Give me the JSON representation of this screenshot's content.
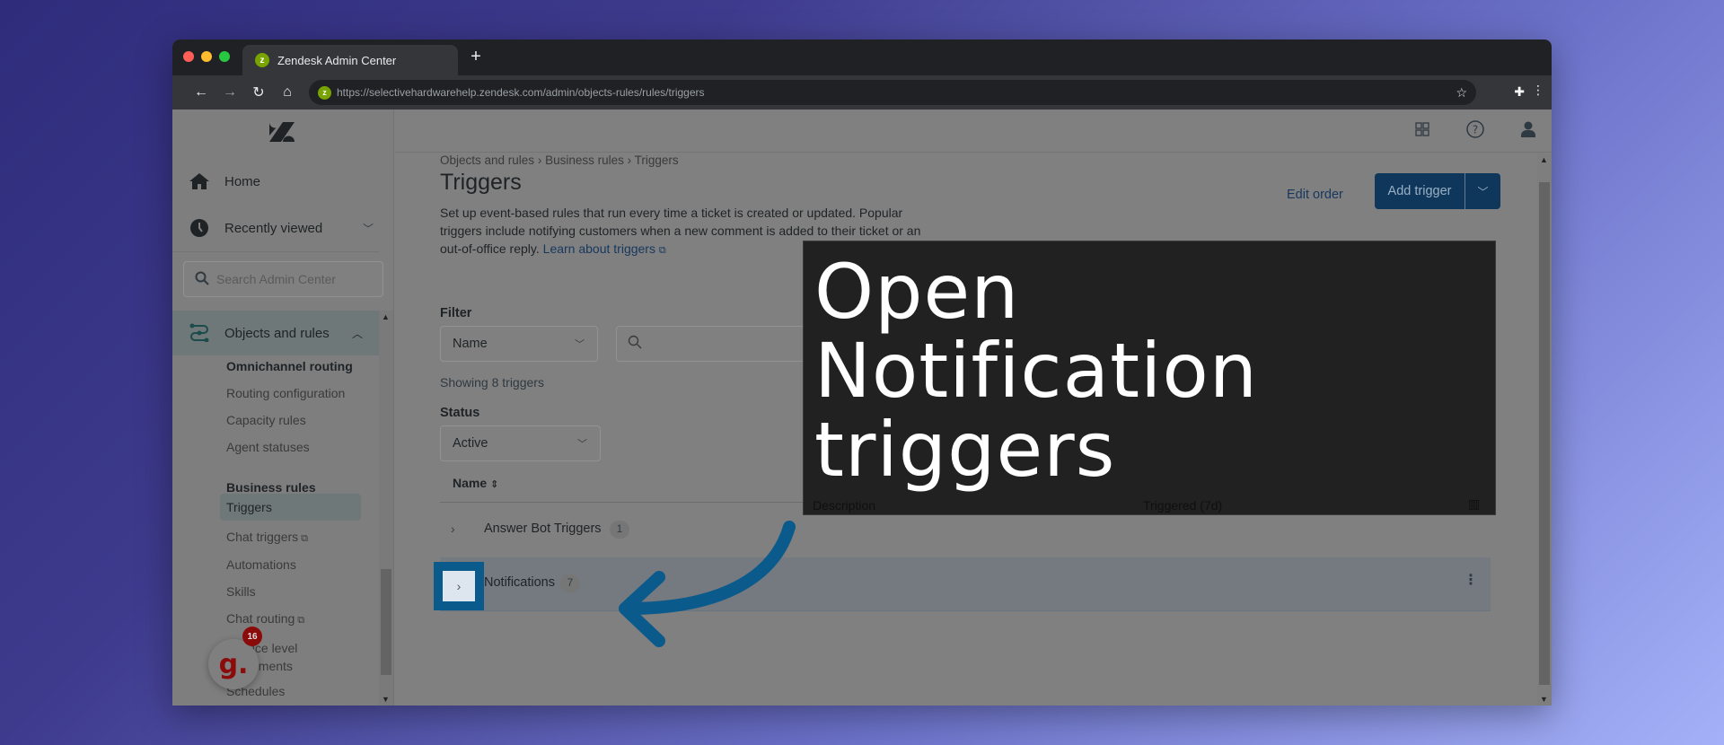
{
  "browser": {
    "tab_title": "Zendesk Admin Center",
    "favicon_letter": "z",
    "new_tab": "+",
    "url": "https://selectivehardwarehelp.zendesk.com/admin/objects-rules/rules/triggers",
    "nav": {
      "back": "←",
      "forward": "→",
      "reload": "↻",
      "home": "⌂"
    },
    "star": "☆",
    "extensions": "✚",
    "menu": "⋮"
  },
  "sidebar": {
    "home": "Home",
    "recently_viewed": "Recently viewed",
    "search_placeholder": "Search Admin Center",
    "section": "Objects and rules",
    "groups": [
      {
        "heading": "Omnichannel routing",
        "items": [
          "Routing configuration",
          "Capacity rules",
          "Agent statuses"
        ]
      },
      {
        "heading": "Business rules",
        "items": [
          "Triggers",
          "Chat triggers",
          "Automations",
          "Skills",
          "Chat routing",
          "Service level agreements",
          "Schedules"
        ]
      }
    ],
    "service_level_line1": "Service level",
    "service_level_line2": "agreements",
    "active_item": "Triggers"
  },
  "widget": {
    "letter": "g.",
    "badge": "16"
  },
  "main": {
    "breadcrumb": [
      "Objects and rules",
      "Business rules",
      "Triggers"
    ],
    "breadcrumb_sep": "›",
    "title": "Triggers",
    "description": "Set up event-based rules that run every time a ticket is created or updated. Popular triggers include notifying customers when a new comment is added to their ticket or an out-of-office reply.",
    "learn_link": "Learn about triggers",
    "edit_order": "Edit order",
    "add_trigger": "Add trigger",
    "filter_label": "Filter",
    "filter_value": "Name",
    "search_value": "",
    "showing": "Showing 8 triggers",
    "status_label": "Status",
    "status_value": "Active",
    "table": {
      "headers": [
        "Name",
        "Description",
        "Triggered (7d)"
      ],
      "rows": [
        {
          "name": "Answer Bot Triggers",
          "count": "1"
        },
        {
          "name": "Notifications",
          "count": "7"
        }
      ]
    }
  },
  "callout": {
    "line1": "Open",
    "line2": "Notification",
    "line3": "triggers"
  },
  "colors": {
    "accent": "#0a5a8c",
    "primary_button": "#0f375c",
    "overlay": "#212121"
  }
}
